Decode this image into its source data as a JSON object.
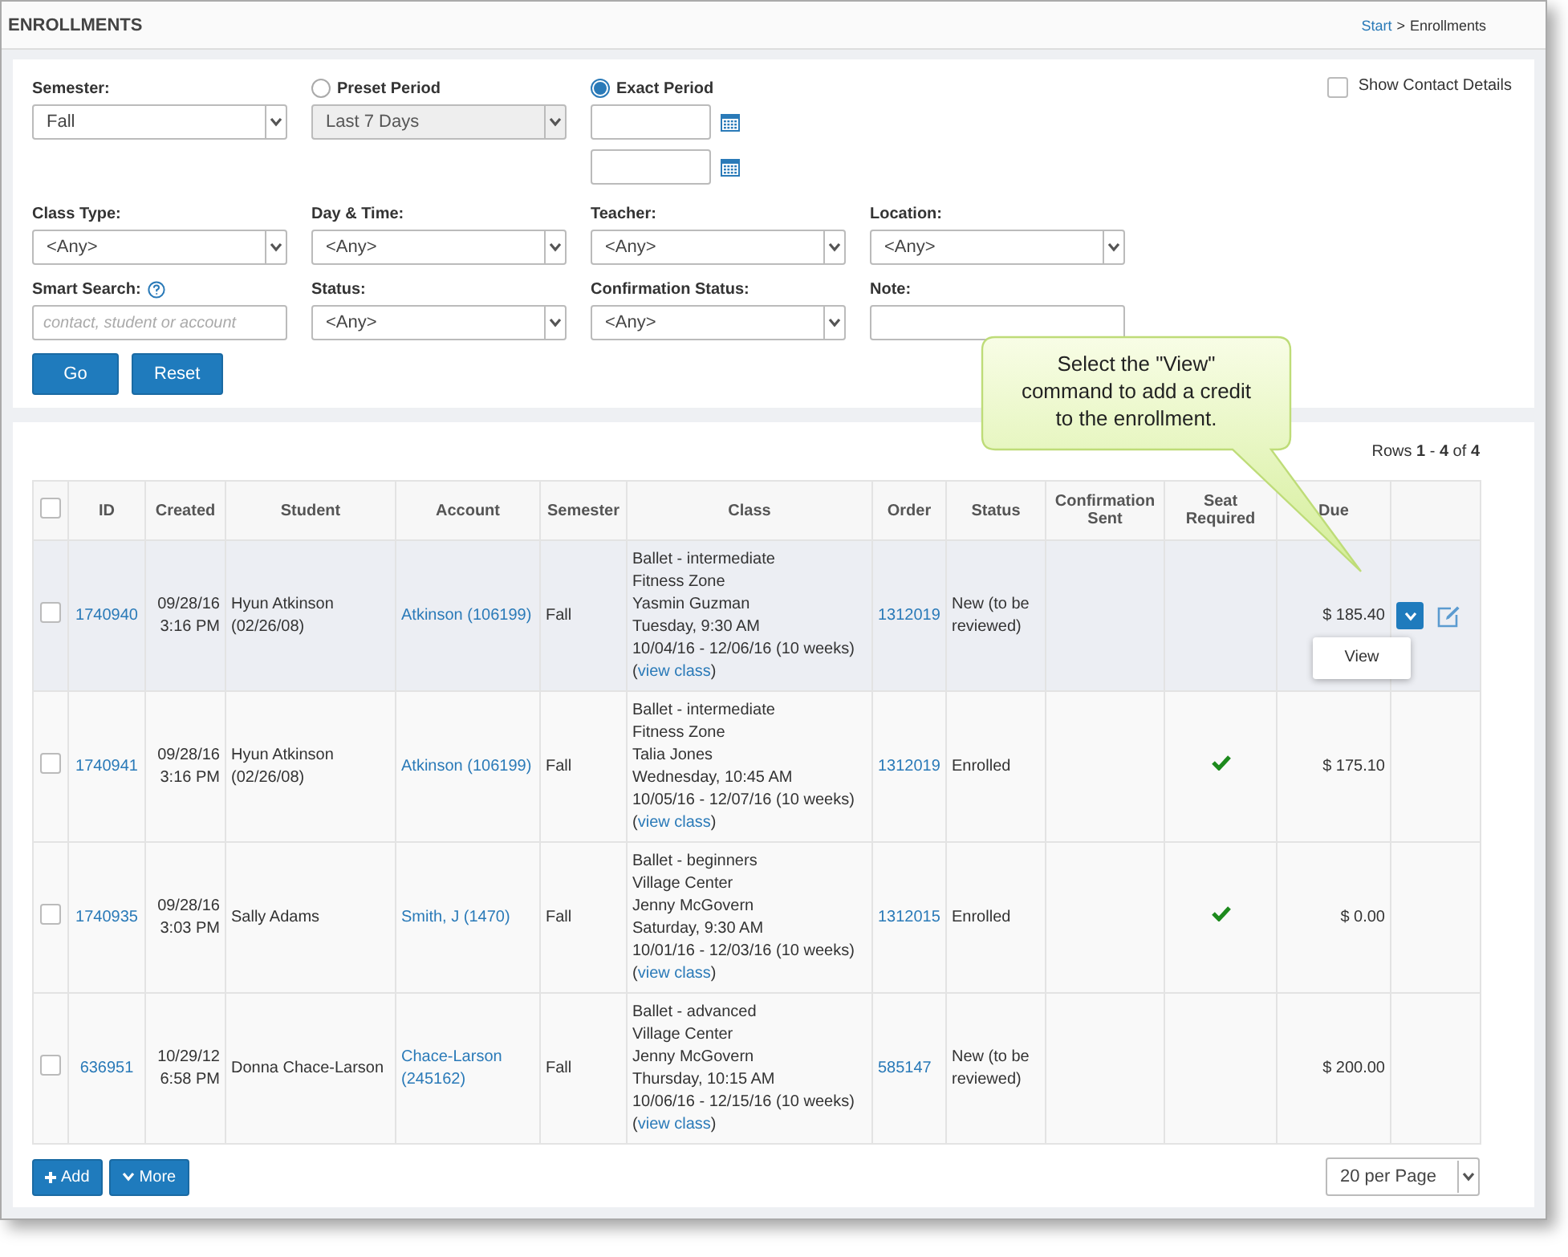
{
  "header": {
    "title": "ENROLLMENTS",
    "breadcrumb": [
      {
        "label": "Start",
        "kind": "link"
      },
      {
        "label": ">",
        "kind": "separator"
      },
      {
        "label": "Enrollments",
        "kind": "current"
      }
    ]
  },
  "filters": {
    "semester": {
      "label": "Semester:",
      "value": "Fall"
    },
    "preset_period": {
      "label": "Preset Period",
      "selected": false,
      "value": "Last 7 Days",
      "disabled": true
    },
    "exact_period": {
      "label": "Exact Period",
      "selected": true
    },
    "show_contact_details": {
      "label": "Show Contact Details",
      "checked": false
    },
    "fields": [
      {
        "kind": "select",
        "label": "Class Type:",
        "value": "<Any>"
      },
      {
        "kind": "select",
        "label": "Day & Time:",
        "value": "<Any>"
      },
      {
        "kind": "select",
        "label": "Teacher:",
        "value": "<Any>"
      },
      {
        "kind": "select",
        "label": "Location:",
        "value": "<Any>"
      },
      {
        "kind": "text",
        "label": "Smart Search:",
        "placeholder": "contact, student or account",
        "help": true
      },
      {
        "kind": "select",
        "label": "Status:",
        "value": "<Any>"
      },
      {
        "kind": "select",
        "label": "Confirmation Status:",
        "value": "<Any>"
      },
      {
        "kind": "text",
        "label": "Note:"
      }
    ],
    "buttons": [
      "Go",
      "Reset"
    ]
  },
  "callout": {
    "text": "Select the \"View\" command to add a credit to the enrollment."
  },
  "table": {
    "rows_info": "Rows **1** - **4** of **4**",
    "select_all_checked": false,
    "columns": [
      "ID",
      "Created",
      "Student",
      "Account",
      "Semester",
      "Class",
      "Order",
      "Status",
      "Confirmation Sent",
      "Seat Required",
      "Due"
    ],
    "rows": [
      {
        "checked": false,
        "highlighted": true,
        "id": "1740940",
        "created_date": "09/28/16",
        "created_time": "3:16 PM",
        "student": "Hyun Atkinson (02/26/08)",
        "account": "Atkinson (106199)",
        "semester": "Fall",
        "class_lines": [
          "Ballet - intermediate",
          "Fitness Zone",
          "Yasmin Guzman",
          "Tuesday, 9:30 AM",
          "10/04/16 - 12/06/16 (10 weeks)"
        ],
        "class_link": {
          "before": "(",
          "link": "view class",
          "after": ")"
        },
        "order": "1312019",
        "status": "New (to be reviewed)",
        "seat_required": false,
        "due": "$ 185.40",
        "menu": [
          "View"
        ]
      },
      {
        "checked": false,
        "highlighted": false,
        "id": "1740941",
        "created_date": "09/28/16",
        "created_time": "3:16 PM",
        "student": "Hyun Atkinson (02/26/08)",
        "account": "Atkinson (106199)",
        "semester": "Fall",
        "class_lines": [
          "Ballet - intermediate",
          "Fitness Zone",
          "Talia Jones",
          "Wednesday, 10:45 AM",
          "10/05/16 - 12/07/16 (10 weeks)"
        ],
        "class_link": {
          "before": "(",
          "link": "view class",
          "after": ")"
        },
        "order": "1312019",
        "status": "Enrolled",
        "seat_required": true,
        "due": "$ 175.10"
      },
      {
        "checked": false,
        "highlighted": false,
        "id": "1740935",
        "created_date": "09/28/16",
        "created_time": "3:03 PM",
        "student": "Sally Adams",
        "account": "Smith, J (1470)",
        "semester": "Fall",
        "class_lines": [
          "Ballet - beginners",
          "Village Center",
          "Jenny McGovern",
          "Saturday, 9:30 AM",
          "10/01/16 - 12/03/16 (10 weeks)"
        ],
        "class_link": {
          "before": "(",
          "link": "view class",
          "after": ")"
        },
        "order": "1312015",
        "status": "Enrolled",
        "seat_required": true,
        "due": "$ 0.00"
      },
      {
        "checked": false,
        "highlighted": false,
        "id": "636951",
        "created_date": "10/29/12",
        "created_time": "6:58 PM",
        "student": "Donna Chace-Larson",
        "account": "Chace-Larson (245162)",
        "semester": "Fall",
        "class_lines": [
          "Ballet - advanced",
          "Village Center",
          "Jenny McGovern",
          "Thursday, 10:15 AM",
          "10/06/16 - 12/15/16 (10 weeks)"
        ],
        "class_link": {
          "before": "(",
          "link": "view class",
          "after": ")"
        },
        "order": "585147",
        "status": "New (to be reviewed)",
        "seat_required": false,
        "due": "$ 200.00"
      }
    ]
  },
  "footer": {
    "buttons": [
      {
        "kind": "add",
        "label": "Add"
      },
      {
        "kind": "more",
        "label": "More"
      }
    ],
    "page_size": "20 per Page"
  }
}
